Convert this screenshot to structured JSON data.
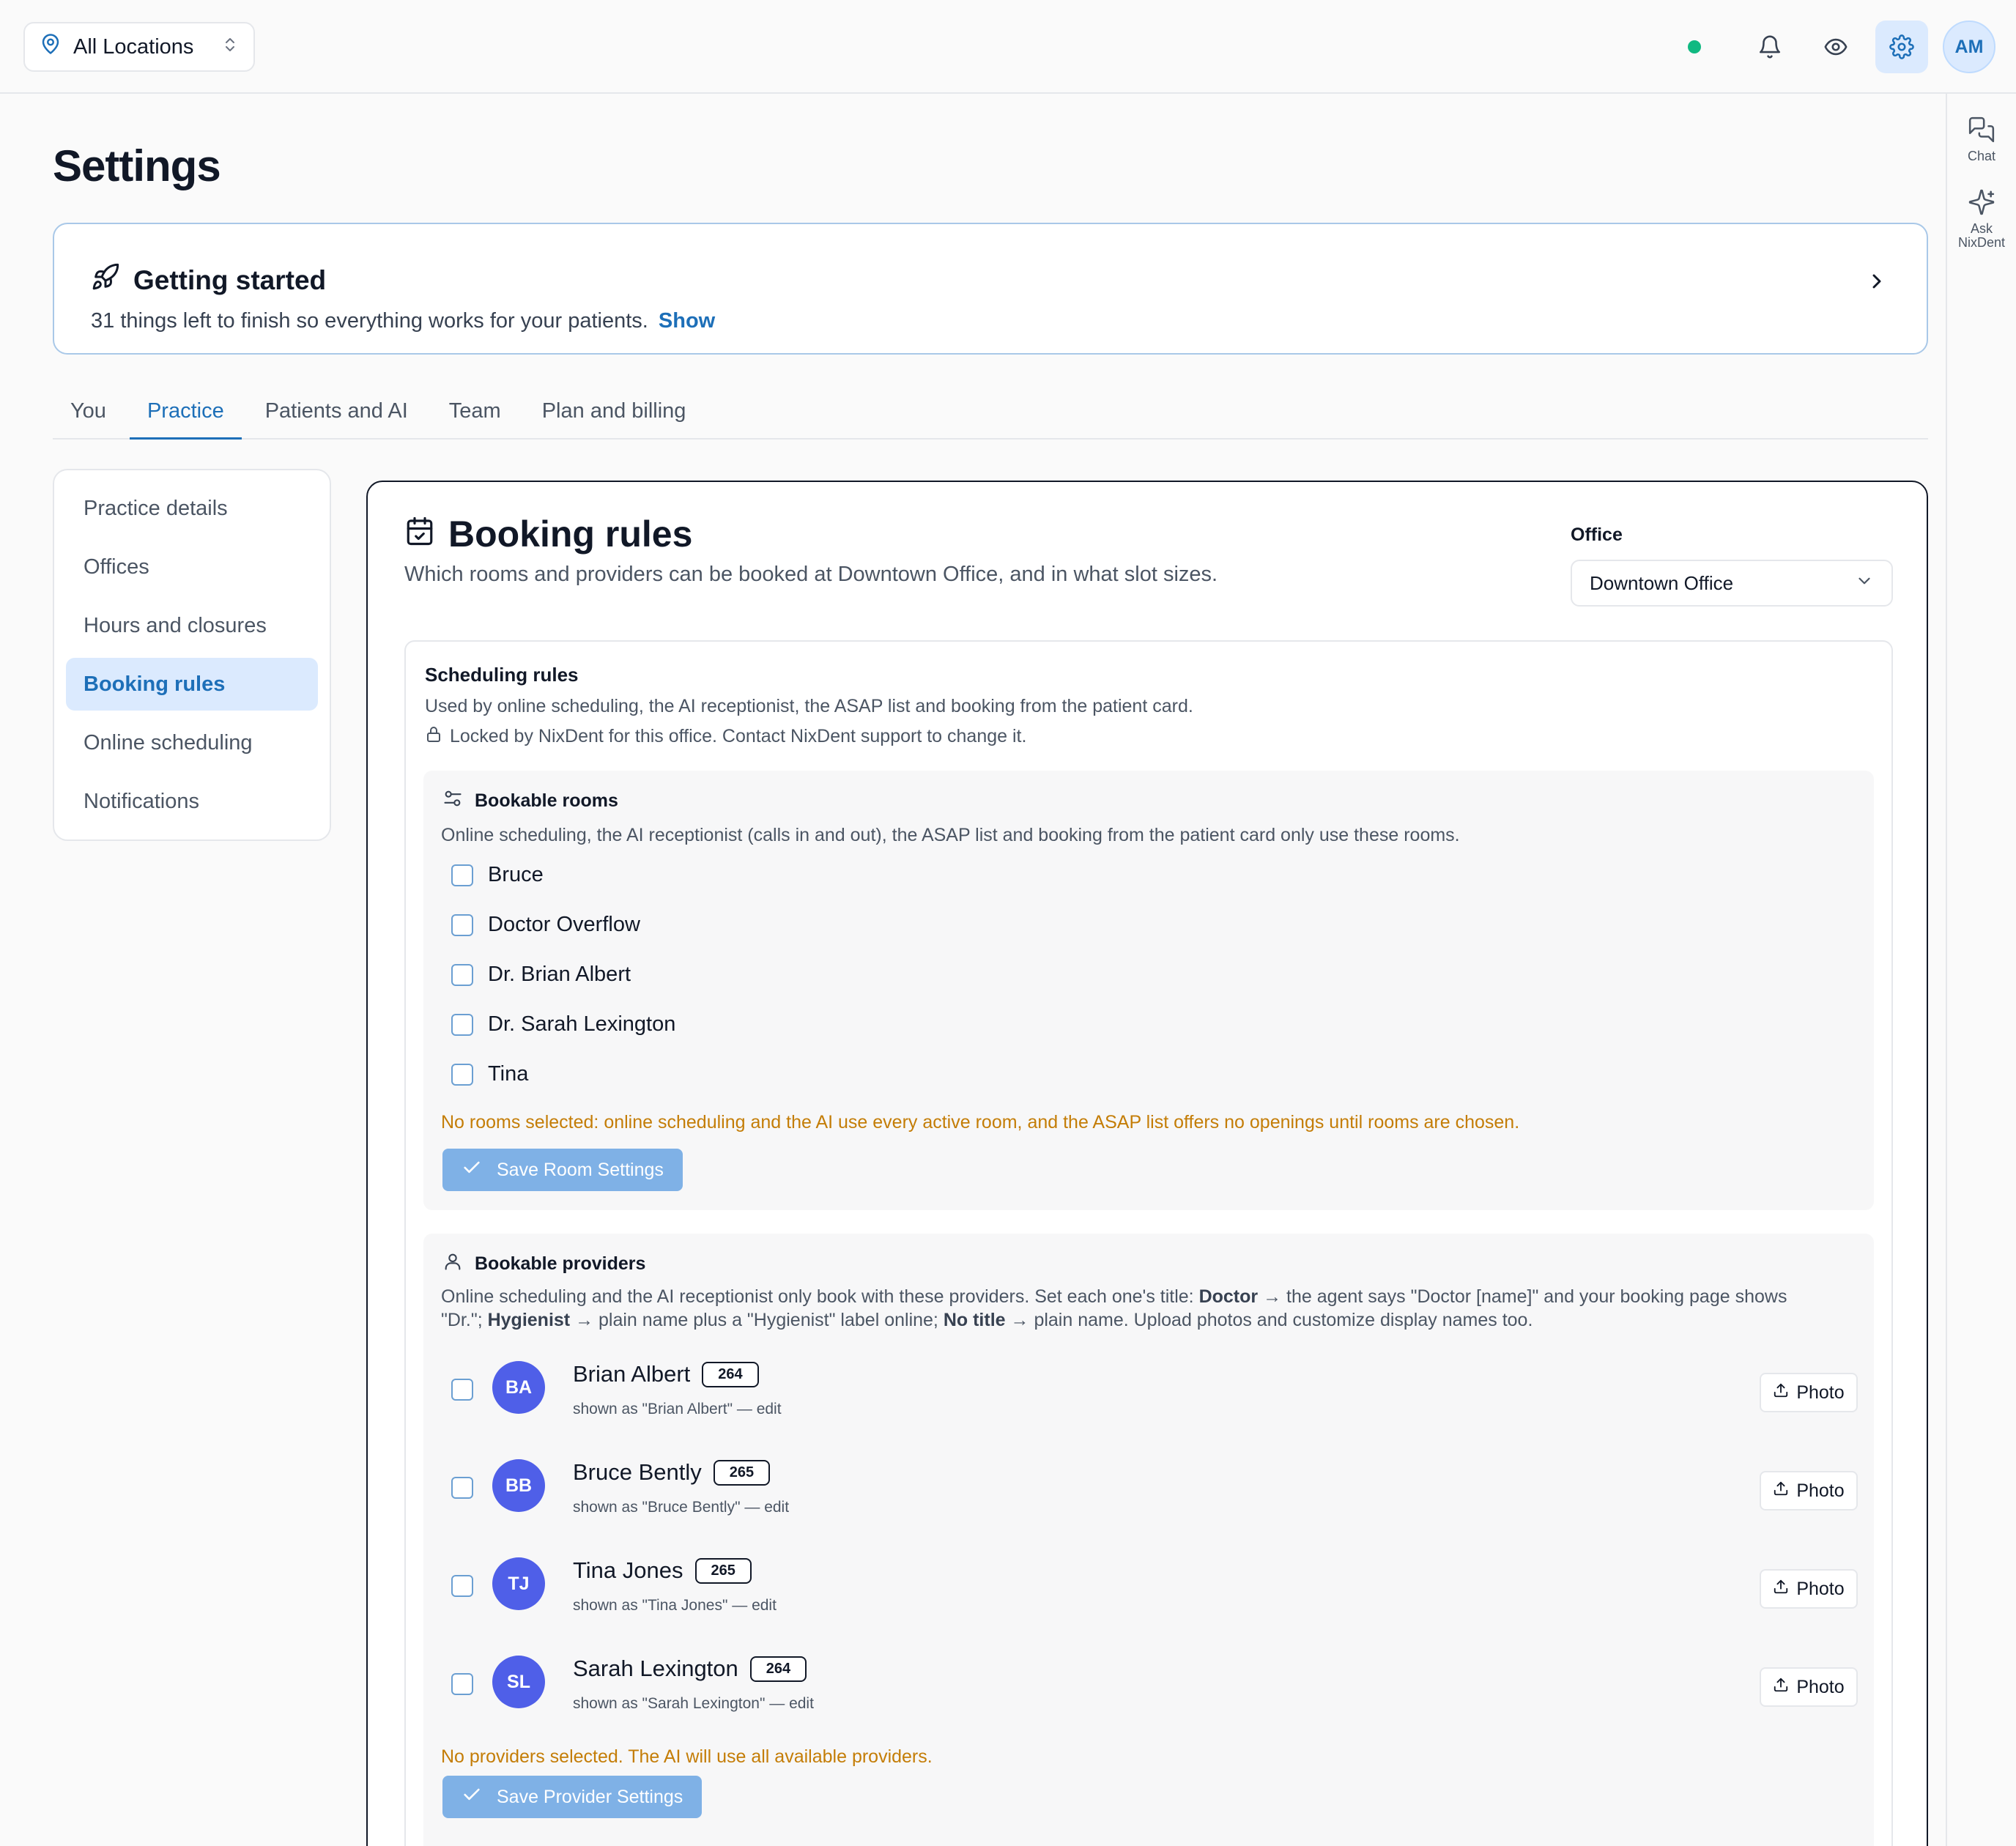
{
  "topbar": {
    "location_label": "All Locations",
    "avatar_initials": "AM"
  },
  "rail": {
    "chat_label": "Chat",
    "ask_label_1": "Ask",
    "ask_label_2": "NixDent"
  },
  "page": {
    "title": "Settings"
  },
  "getting_started": {
    "title": "Getting started",
    "subtitle": "31 things left to finish so everything works for your patients.",
    "show_link": "Show"
  },
  "tabs": [
    "You",
    "Practice",
    "Patients and AI",
    "Team",
    "Plan and billing"
  ],
  "active_tab": "Practice",
  "sidenav": [
    "Practice details",
    "Offices",
    "Hours and closures",
    "Booking rules",
    "Online scheduling",
    "Notifications"
  ],
  "active_sidenav": "Booking rules",
  "booking": {
    "title": "Booking rules",
    "subtitle": "Which rooms and providers can be booked at Downtown Office, and in what slot sizes.",
    "office_label": "Office",
    "office_value": "Downtown Office"
  },
  "scheduling": {
    "title": "Scheduling rules",
    "subtitle": "Used by online scheduling, the AI receptionist, the ASAP list and booking from the patient card.",
    "locked": "Locked by NixDent for this office. Contact NixDent support to change it."
  },
  "rooms": {
    "title": "Bookable rooms",
    "description": "Online scheduling, the AI receptionist (calls in and out), the ASAP list and booking from the patient card only use these rooms.",
    "items": [
      "Bruce",
      "Doctor Overflow",
      "Dr. Brian Albert",
      "Dr. Sarah Lexington",
      "Tina"
    ],
    "warning": "No rooms selected: online scheduling and the AI use every active room, and the ASAP list offers no openings until rooms are chosen.",
    "save_label": "Save Room Settings"
  },
  "providers": {
    "title": "Bookable providers",
    "desc_1": "Online scheduling and the AI receptionist only book with these providers. Set each one's title: ",
    "desc_b1": "Doctor",
    "desc_2": " → the agent says \"Doctor [name]\" and your booking page shows",
    "desc_3": "\"Dr.\"; ",
    "desc_b2": "Hygienist",
    "desc_4": " → plain name plus a \"Hygienist\" label online; ",
    "desc_b3": "No title",
    "desc_5": " → plain name. Upload photos and customize display names too.",
    "items": [
      {
        "initials": "BA",
        "name": "Brian Albert",
        "badge": "264",
        "shown": "shown as \"Brian Albert\" — edit",
        "photo": "Photo"
      },
      {
        "initials": "BB",
        "name": "Bruce Bently",
        "badge": "265",
        "shown": "shown as \"Bruce Bently\" — edit",
        "photo": "Photo"
      },
      {
        "initials": "TJ",
        "name": "Tina Jones",
        "badge": "265",
        "shown": "shown as \"Tina Jones\" — edit",
        "photo": "Photo"
      },
      {
        "initials": "SL",
        "name": "Sarah Lexington",
        "badge": "264",
        "shown": "shown as \"Sarah Lexington\" — edit",
        "photo": "Photo"
      }
    ],
    "warning": "No providers selected. The AI will use all available providers.",
    "save_label": "Save Provider Settings"
  },
  "colors": {
    "accent": "#1d6fb8",
    "warning": "#c47d07",
    "status_online": "#10b981",
    "avatar": "#4f5fe8",
    "save_button": "#7fb1e6"
  }
}
